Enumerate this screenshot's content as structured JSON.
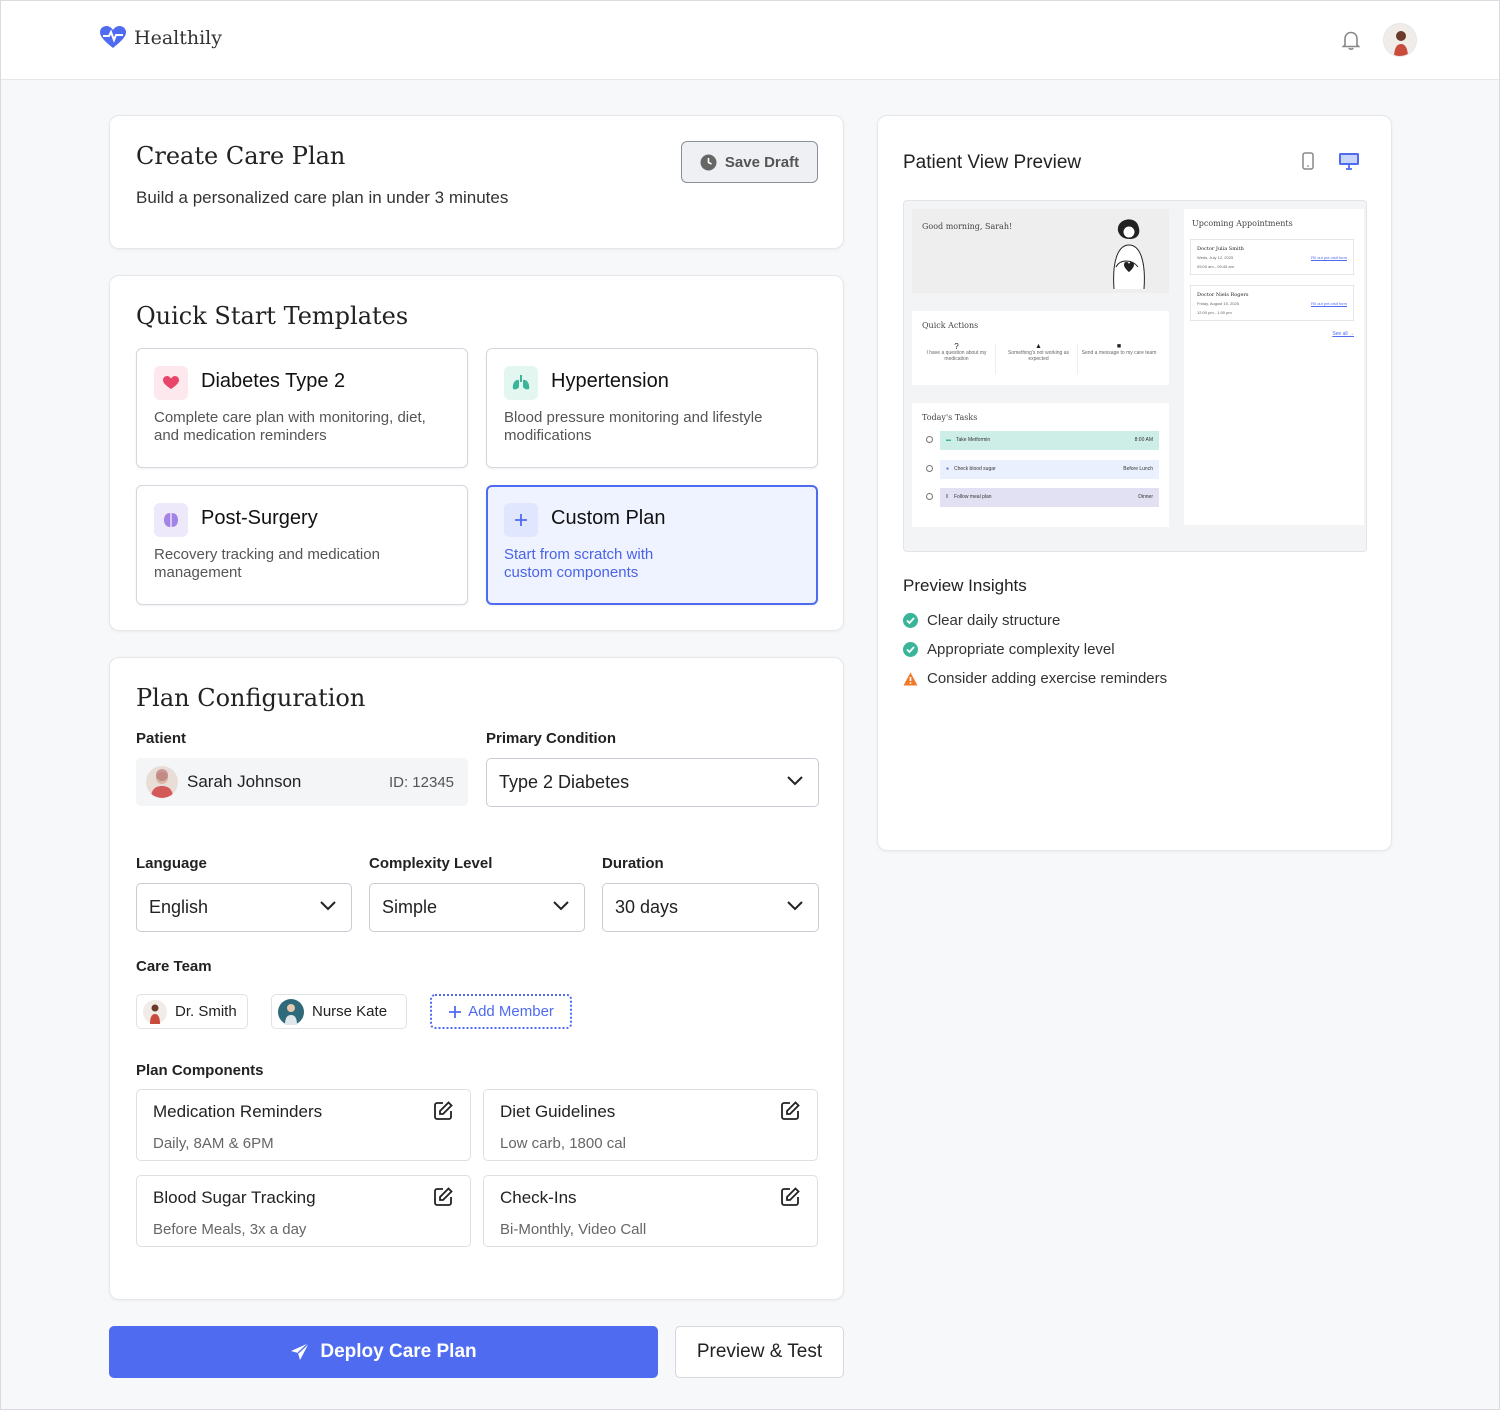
{
  "header": {
    "brand": "Healthily",
    "brand_color": "#4f6bf0"
  },
  "intro": {
    "title": "Create Care Plan",
    "subtitle": "Build a personalized care plan in under 3 minutes",
    "save_label": "Save Draft"
  },
  "templates": {
    "heading": "Quick Start Templates",
    "items": [
      {
        "name": "Diabetes Type 2",
        "desc": "Complete care plan with monitoring, diet, and medication reminders",
        "icon": "heart-icon"
      },
      {
        "name": "Hypertension",
        "desc": "Blood pressure monitoring and lifestyle modifications",
        "icon": "lungs-icon"
      },
      {
        "name": "Post-Surgery",
        "desc": "Recovery tracking and medication management",
        "icon": "brain-icon"
      },
      {
        "name": "Custom Plan",
        "desc": "Start from scratch with custom components",
        "icon": "plus-icon"
      }
    ]
  },
  "config": {
    "heading": "Plan Configuration",
    "patient_label": "Patient",
    "patient_name": "Sarah Johnson",
    "patient_id": "ID: 12345",
    "condition_label": "Primary Condition",
    "condition_value": "Type 2 Diabetes",
    "language_label": "Language",
    "language_value": "English",
    "complexity_label": "Complexity Level",
    "complexity_value": "Simple",
    "duration_label": "Duration",
    "duration_value": "30 days",
    "team_label": "Care Team",
    "team": [
      "Dr. Smith",
      "Nurse Kate"
    ],
    "add_member": "Add Member",
    "components_label": "Plan Components",
    "components": [
      {
        "title": "Medication Reminders",
        "detail": "Daily, 8AM & 6PM"
      },
      {
        "title": "Diet Guidelines",
        "detail": "Low carb, 1800 cal"
      },
      {
        "title": "Blood Sugar Tracking",
        "detail": "Before Meals, 3x a day"
      },
      {
        "title": "Check-Ins",
        "detail": "Bi-Monthly, Video Call"
      }
    ]
  },
  "actions": {
    "deploy": "Deploy Care Plan",
    "preview": "Preview & Test"
  },
  "preview": {
    "title": "Patient View Preview",
    "greeting": "Good morning, Sarah!",
    "quick_actions_title": "Quick Actions",
    "quick_actions": [
      "I have a question about my medication",
      "Something's not working as expected",
      "Send a message to my care team"
    ],
    "tasks_title": "Today's Tasks",
    "tasks": [
      {
        "name": "Take Metformin",
        "when": "8:00 AM"
      },
      {
        "name": "Check blood sugar",
        "when": "Before Lunch"
      },
      {
        "name": "Follow meal plan",
        "when": "Dinner"
      }
    ],
    "appointments_title": "Upcoming Appointments",
    "appointments": [
      {
        "doctor": "Doctor Julia Smith",
        "date": "Weds, July 12, 2025",
        "time": "09:00 am - 09:45 am",
        "link": "Fill out pre-visit form"
      },
      {
        "doctor": "Doctor Niels Rogers",
        "date": "Friday, August 15, 2025",
        "time": "12:00 pm - 1:00 pm",
        "link": "Fill out pre-visit form"
      }
    ],
    "see_all": "See all →"
  },
  "insights": {
    "title": "Preview Insights",
    "items": [
      {
        "text": "Clear daily structure",
        "status": "ok"
      },
      {
        "text": "Appropriate complexity level",
        "status": "ok"
      },
      {
        "text": "Consider adding exercise reminders",
        "status": "warning"
      }
    ],
    "ok_color": "#3bb59a",
    "warning_color": "#f07a2a"
  }
}
